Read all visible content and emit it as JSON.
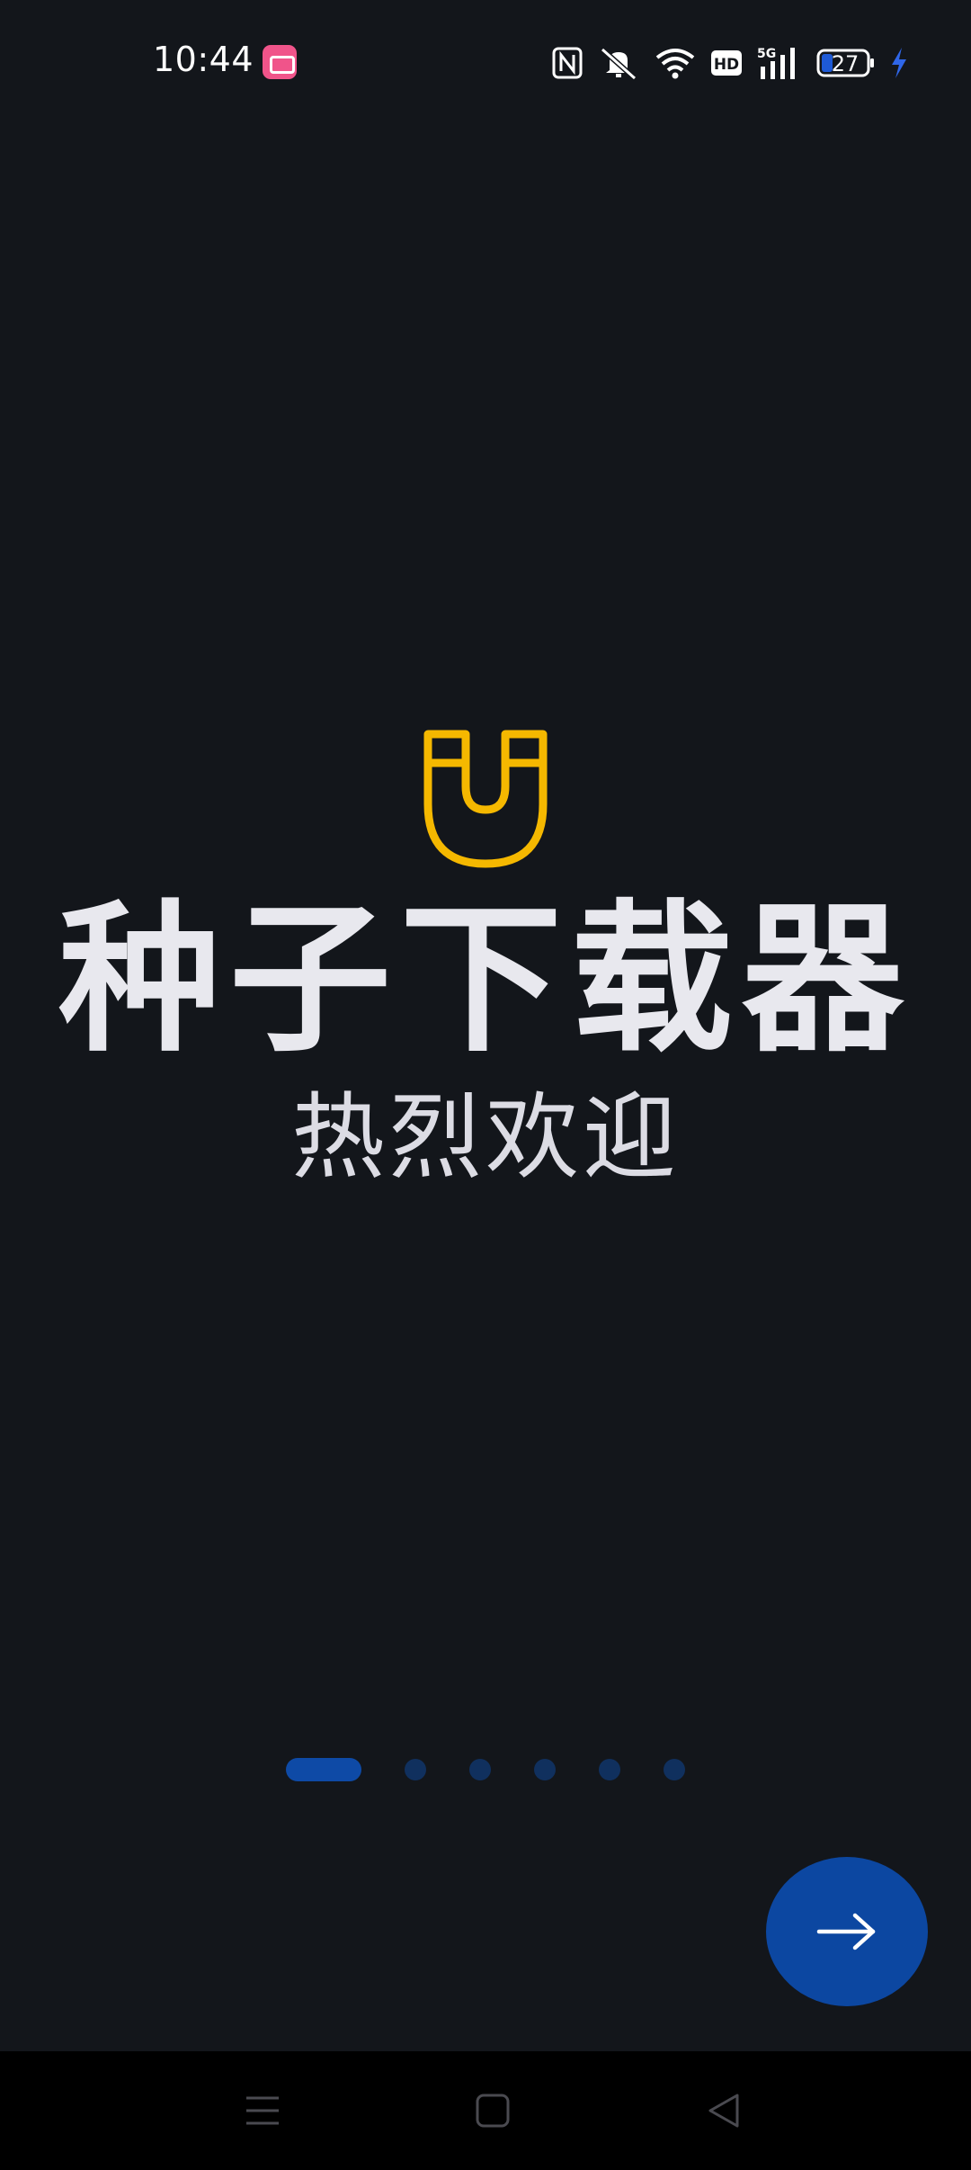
{
  "status_bar": {
    "time": "10:44",
    "notification_app_icon": "bilibili-icon",
    "icons": [
      "nfc-icon",
      "mute-icon",
      "wifi-icon",
      "hd-icon",
      "signal-5g-icon",
      "battery-icon",
      "charging-icon"
    ],
    "battery_level": "27"
  },
  "welcome": {
    "logo_icon": "magnet-icon",
    "title": "种子下载器",
    "subtitle": "热烈欢迎"
  },
  "pager": {
    "page_count": 6,
    "active_page": 1
  },
  "next_button": {
    "icon": "arrow-right-icon"
  },
  "nav_bar": {
    "icons": [
      "menu-icon",
      "home-icon",
      "back-icon"
    ]
  },
  "colors": {
    "background": "#13161b",
    "accent_blue": "#0c47a1",
    "logo_yellow": "#f5b800",
    "dot_inactive": "#10305e"
  }
}
